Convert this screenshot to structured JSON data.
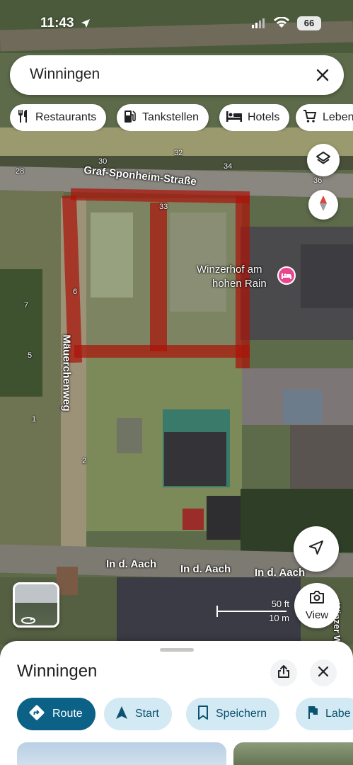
{
  "status_bar": {
    "time": "11:43",
    "battery": "66"
  },
  "search": {
    "query": "Winningen"
  },
  "chips": [
    {
      "label": "Restaurants",
      "icon": "fork-knife-icon"
    },
    {
      "label": "Tankstellen",
      "icon": "gas-station-icon"
    },
    {
      "label": "Hotels",
      "icon": "bed-icon"
    },
    {
      "label": "Leben",
      "icon": "cart-icon"
    }
  ],
  "map": {
    "streets": {
      "graf": "Graf-Sponheim-Straße",
      "mauerchen": "Mäuerchenweg",
      "aach": "In d. Aach",
      "aach2": "In d. Aach",
      "aach3": "In d. Aach",
      "wine": "Winzer Weg"
    },
    "poi": {
      "line1": "Winzerhof am",
      "line2": "hohen Rain",
      "icon": "hotel-pin-icon",
      "color": "#e8478f"
    },
    "house_numbers": {
      "n30": "30",
      "n32": "32",
      "n34": "34",
      "n36": "36",
      "n28": "28",
      "n33": "33",
      "n6": "6",
      "n7": "7",
      "n5": "5",
      "n1": "1",
      "n2": "2"
    },
    "scale": {
      "feet": "50 ft",
      "meters": "10 m"
    },
    "outline_color": "#aa140a",
    "view_label": "View"
  },
  "place": {
    "title": "Winningen",
    "actions": [
      {
        "label": "Route",
        "icon": "directions-icon"
      },
      {
        "label": "Start",
        "icon": "navigation-arrow-icon"
      },
      {
        "label": "Speichern",
        "icon": "bookmark-icon"
      },
      {
        "label": "Labe",
        "icon": "flag-icon"
      }
    ]
  }
}
